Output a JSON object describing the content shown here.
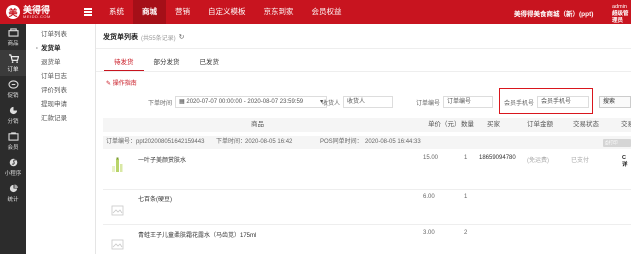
{
  "header": {
    "logo_cn": "美得得",
    "logo_en": "MEIDD.COM",
    "nav": [
      "系统",
      "商城",
      "营销",
      "自定义模板",
      "京东到家",
      "会员权益"
    ],
    "active_nav": "商城",
    "store_name": "美得得美食商城（新）(ppt)",
    "user": "admin",
    "role": "超级管理员"
  },
  "sidebar": {
    "items": [
      {
        "label": "商品",
        "icon": "goods-icon"
      },
      {
        "label": "订单",
        "icon": "cart-icon"
      },
      {
        "label": "促销",
        "icon": "promo-icon"
      },
      {
        "label": "分销",
        "icon": "share-icon"
      },
      {
        "label": "会员",
        "icon": "member-icon"
      },
      {
        "label": "小程序",
        "icon": "miniprogram-icon"
      },
      {
        "label": "统计",
        "icon": "stats-icon"
      }
    ]
  },
  "submenu": {
    "items": [
      "订单列表",
      "发货单",
      "退货单",
      "订单日志",
      "评价列表",
      "提现申请",
      "汇款记录"
    ],
    "active": "发货单"
  },
  "page": {
    "title": "发货单列表",
    "count": "(共55条记录)",
    "tabs": [
      "待发货",
      "部分发货",
      "已发货"
    ],
    "op_guide": "操作指南"
  },
  "filter": {
    "time_label": "下单时间",
    "time_value": "2020-07-07 00:00:00 - 2020-08-07 23:59:59",
    "receiver_label": "收货人",
    "receiver_placeholder": "收货人",
    "order_no_label": "订单编号",
    "order_no_placeholder": "订单编号",
    "phone_label": "会员手机号",
    "phone_placeholder": "会员手机号",
    "search_label": "搜索"
  },
  "table": {
    "headers": [
      "商品",
      "单价（元）",
      "数量",
      "买家",
      "订单金额",
      "交易状态",
      "交易"
    ]
  },
  "order": {
    "order_no_label": "订单编号：",
    "order_no": "ppt202008051642159443",
    "order_time_label": "下单时间：",
    "order_time": "2020-08-05 16:42",
    "pos_label": "POS同单时间：",
    "pos_time": "2020-08-05 16:44:33",
    "print_label": "打印"
  },
  "products": [
    {
      "name": "一叶子美颜赏肤水",
      "price": "15.00",
      "qty": "1",
      "buyer": "18659094780",
      "amount": "(免运费)",
      "status": "已支付",
      "last": "C\n详"
    },
    {
      "name": "七百条(硬豆)",
      "price": "6.00",
      "qty": "1",
      "buyer": "",
      "amount": "",
      "status": "",
      "last": ""
    },
    {
      "name": "青蛙王子儿童柔肤霜花露水（马齿苋）175ml",
      "price": "3.00",
      "qty": "2",
      "buyer": "",
      "amount": "",
      "status": "",
      "last": ""
    }
  ],
  "colors": {
    "brand": "#c8141f",
    "sidebar": "#2c2c2c"
  }
}
